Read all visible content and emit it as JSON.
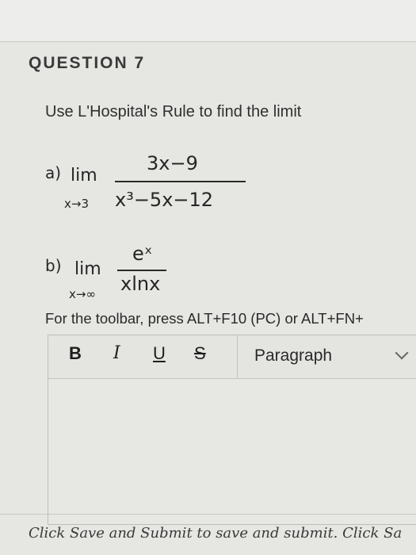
{
  "question": {
    "title": "QUESTION 7",
    "prompt": "Use L'Hospital's Rule to find the limit"
  },
  "part_a": {
    "label": "a)",
    "lim_word": "lim",
    "subscript": "x→3",
    "numerator": "3x−9",
    "denominator": "x³−5x−12"
  },
  "part_b": {
    "label": "b)",
    "lim_word": "lim",
    "subscript": "x→∞",
    "numerator": "eˣ",
    "denominator": "xlnx"
  },
  "toolbar_hint": "For the toolbar, press ALT+F10 (PC) or ALT+FN+",
  "editor": {
    "bold_label": "B",
    "italic_label": "I",
    "underline_label": "U",
    "strike_label": "S",
    "paragraph_label": "Paragraph"
  },
  "footer": {
    "text": "Click Save and Submit to save and submit. Click Sa"
  }
}
